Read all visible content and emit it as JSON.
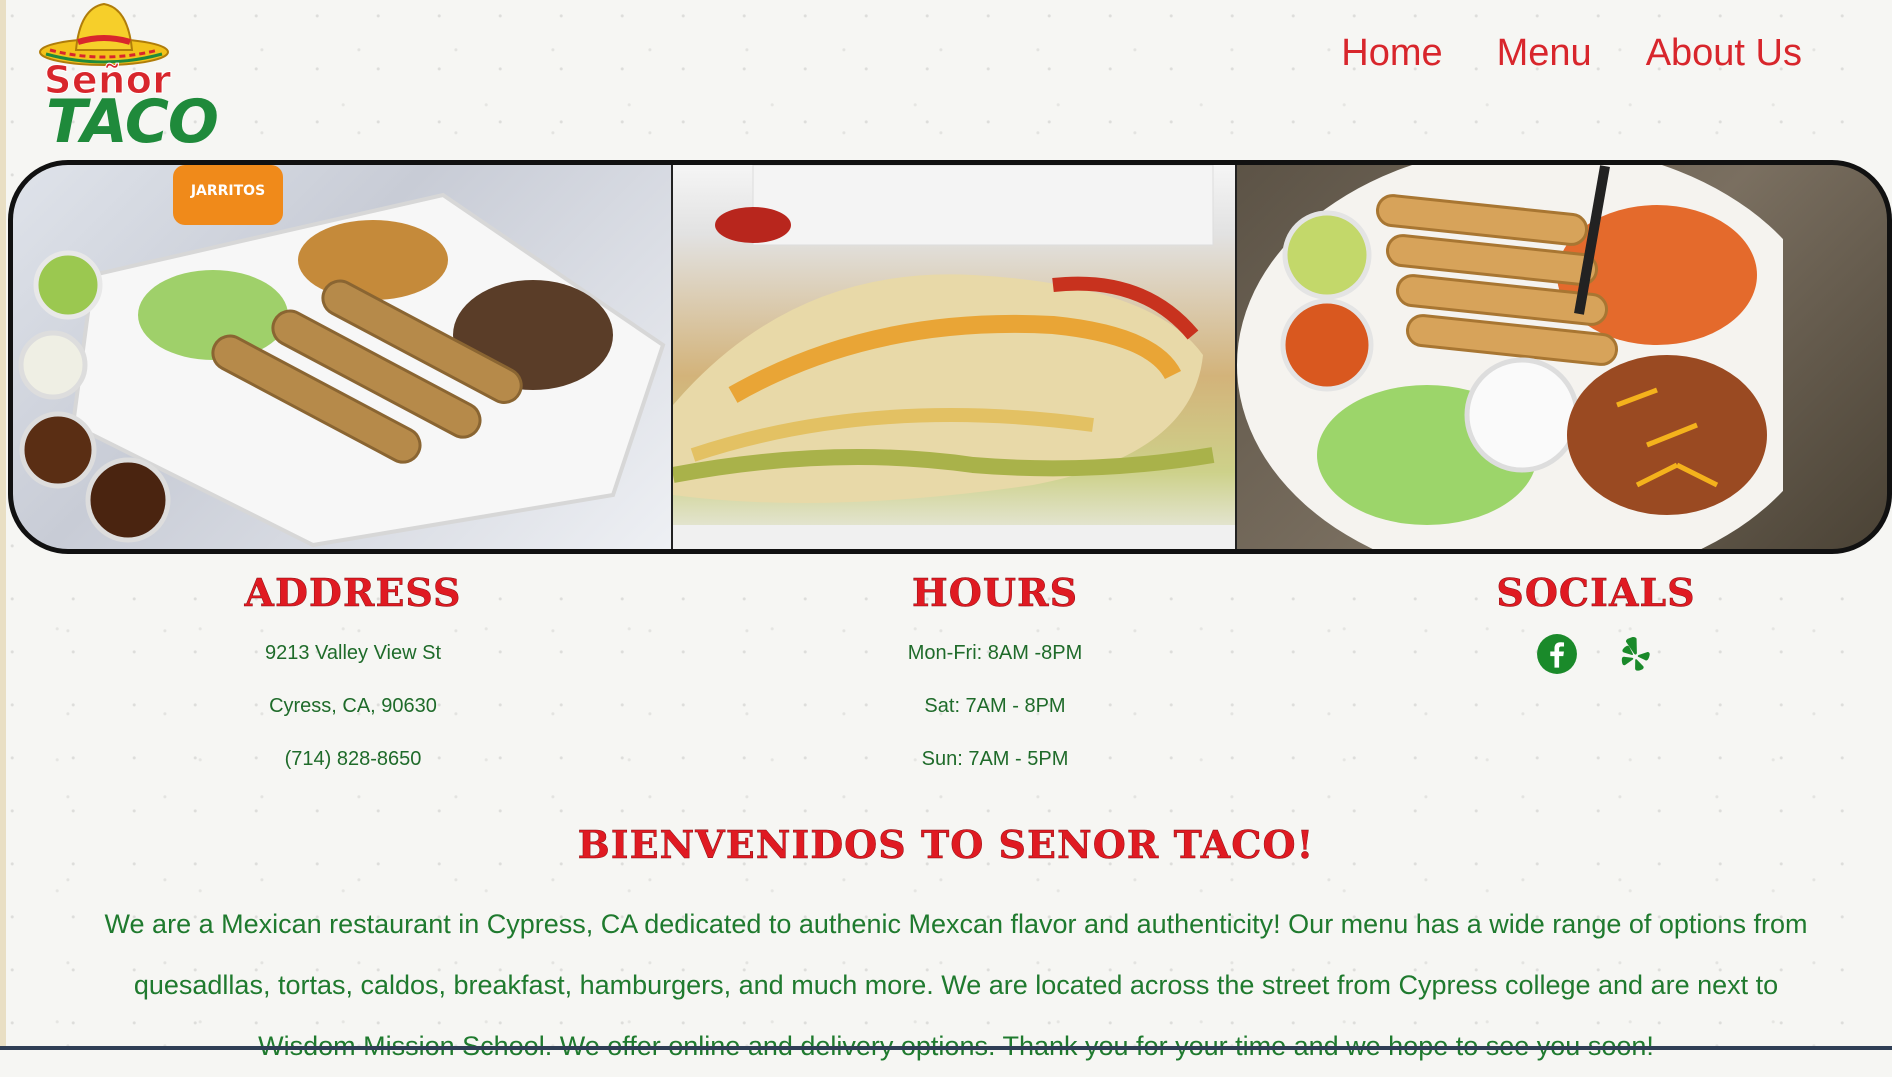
{
  "logo": {
    "line1": "Señor",
    "line2": "TACO"
  },
  "nav": {
    "items": [
      "Home",
      "Menu",
      "About Us"
    ]
  },
  "hero": {
    "photo_label": "JARRITOS"
  },
  "address": {
    "heading": "ADDRESS",
    "lines": [
      "9213 Valley View St",
      "Cyress, CA, 90630",
      "(714) 828-8650"
    ]
  },
  "hours": {
    "heading": "HOURS",
    "lines": [
      "Mon-Fri: 8AM -8PM",
      "Sat: 7AM - 8PM",
      "Sun: 7AM - 5PM"
    ]
  },
  "socials": {
    "heading": "SOCIALS",
    "icons": [
      "facebook-icon",
      "yelp-icon"
    ],
    "color": "#1a8a2a"
  },
  "welcome": {
    "title": "BIENVENIDOS TO SENOR TACO!",
    "body": "We are a Mexican restaurant in Cypress, CA dedicated to authenic Mexcan flavor and authenticity! Our menu has a wide range of options from quesadllas, tortas, caldos, breakfast, hamburgers, and much more. We are located across the street from Cypress college and are next to Wisdom Mission School. We offer online and delivery options. Thank you for your time and we hope to see you soon!"
  },
  "colors": {
    "brand_red": "#d8262c",
    "brand_green": "#1f7a2e"
  }
}
